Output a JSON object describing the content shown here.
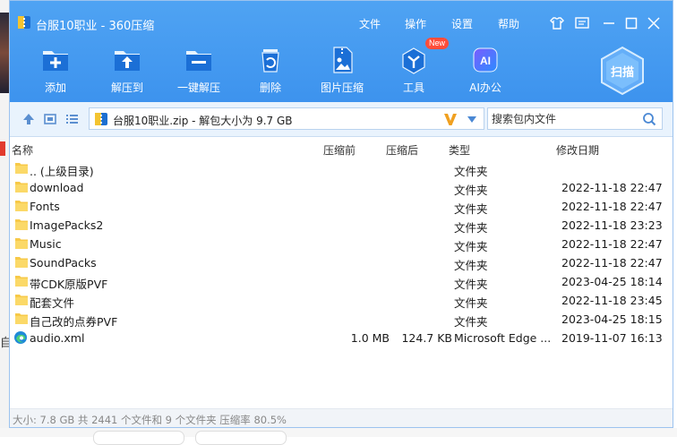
{
  "window": {
    "title": "台服10职业 - 360压缩"
  },
  "menu": [
    "文件",
    "操作",
    "设置",
    "帮助"
  ],
  "toolbar": [
    {
      "label": "添加",
      "icon": "add-icon"
    },
    {
      "label": "解压到",
      "icon": "extract-to-icon"
    },
    {
      "label": "一键解压",
      "icon": "one-click-extract-icon"
    },
    {
      "label": "删除",
      "icon": "trash-icon"
    },
    {
      "label": "图片压缩",
      "icon": "image-compress-icon"
    },
    {
      "label": "工具",
      "icon": "tools-icon",
      "badge": "New"
    },
    {
      "label": "AI办公",
      "icon": "ai-icon"
    }
  ],
  "scan": {
    "label": "扫描"
  },
  "address": {
    "text": "台服10职业.zip - 解包大小为 9.7 GB"
  },
  "search": {
    "placeholder": "搜索包内文件"
  },
  "columns": {
    "name": "名称",
    "size": "压缩前",
    "packed": "压缩后",
    "type": "类型",
    "date": "修改日期"
  },
  "files": [
    {
      "name": ".. (上级目录)",
      "size": "",
      "packed": "",
      "type": "文件夹",
      "date": "",
      "icon": "folder-icon"
    },
    {
      "name": "download",
      "size": "",
      "packed": "",
      "type": "文件夹",
      "date": "2022-11-18 22:47",
      "icon": "folder-icon"
    },
    {
      "name": "Fonts",
      "size": "",
      "packed": "",
      "type": "文件夹",
      "date": "2022-11-18 22:47",
      "icon": "folder-icon"
    },
    {
      "name": "ImagePacks2",
      "size": "",
      "packed": "",
      "type": "文件夹",
      "date": "2022-11-18 23:23",
      "icon": "folder-icon"
    },
    {
      "name": "Music",
      "size": "",
      "packed": "",
      "type": "文件夹",
      "date": "2022-11-18 22:47",
      "icon": "folder-icon"
    },
    {
      "name": "SoundPacks",
      "size": "",
      "packed": "",
      "type": "文件夹",
      "date": "2022-11-18 22:47",
      "icon": "folder-icon"
    },
    {
      "name": "带CDK原版PVF",
      "size": "",
      "packed": "",
      "type": "文件夹",
      "date": "2023-04-25 18:14",
      "icon": "folder-icon"
    },
    {
      "name": "配套文件",
      "size": "",
      "packed": "",
      "type": "文件夹",
      "date": "2022-11-18 23:45",
      "icon": "folder-icon"
    },
    {
      "name": "自己改的点券PVF",
      "size": "",
      "packed": "",
      "type": "文件夹",
      "date": "2023-04-25 18:15",
      "icon": "folder-icon"
    },
    {
      "name": "audio.xml",
      "size": "1.0 MB",
      "packed": "124.7 KB",
      "type": "Microsoft Edge ...",
      "date": "2019-11-07 16:13",
      "icon": "edge-icon"
    }
  ],
  "status": {
    "text": "大小: 7.8 GB 共 2441 个文件和 9 个文件夹 压缩率 80.5%"
  },
  "background": {
    "left_char": "自"
  },
  "colors": {
    "header": "#3d93ee",
    "address_bar": "#e9f3fd",
    "folder": "#f7c948"
  }
}
